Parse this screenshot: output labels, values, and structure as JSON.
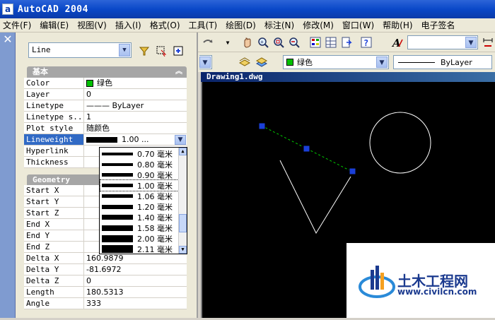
{
  "window": {
    "app_icon": "a",
    "title": "AutoCAD 2004"
  },
  "menu": [
    "文件(F)",
    "编辑(E)",
    "视图(V)",
    "插入(I)",
    "格式(O)",
    "工具(T)",
    "绘图(D)",
    "标注(N)",
    "修改(M)",
    "窗口(W)",
    "帮助(H)",
    "电子签名"
  ],
  "palette": {
    "close_glyph": "✕",
    "object_type": "Line",
    "sections": {
      "basic": "基本",
      "geometry": "Geometry"
    },
    "basic_rows": [
      {
        "name": "Color",
        "value": "绿色",
        "swatch": "#00c000"
      },
      {
        "name": "Layer",
        "value": "0"
      },
      {
        "name": "Linetype",
        "value": "——— ByLayer"
      },
      {
        "name": "Linetype s...",
        "value": "1"
      },
      {
        "name": "Plot style",
        "value": "随颜色"
      },
      {
        "name": "Lineweight",
        "value": "1.00 ..."
      },
      {
        "name": "Hyperlink",
        "value": ""
      },
      {
        "name": "Thickness",
        "value": ""
      }
    ],
    "geometry_rows": [
      {
        "name": "Start X",
        "value": ""
      },
      {
        "name": "Start Y",
        "value": ""
      },
      {
        "name": "Start Z",
        "value": ""
      },
      {
        "name": "End X",
        "value": ""
      },
      {
        "name": "End Y",
        "value": ""
      },
      {
        "name": "End Z",
        "value": ""
      },
      {
        "name": "Delta X",
        "value": "160.9879"
      },
      {
        "name": "Delta Y",
        "value": "-81.6972"
      },
      {
        "name": "Delta Z",
        "value": "0"
      },
      {
        "name": "Length",
        "value": "180.5313"
      },
      {
        "name": "Angle",
        "value": "333"
      }
    ],
    "lineweight_options": [
      {
        "label": "0.70 毫米",
        "weight": 0.7
      },
      {
        "label": "0.80 毫米",
        "weight": 0.8
      },
      {
        "label": "0.90 毫米",
        "weight": 0.9
      },
      {
        "label": "1.00 毫米",
        "weight": 1.0,
        "current": true
      },
      {
        "label": "1.06 毫米",
        "weight": 1.06
      },
      {
        "label": "1.20 毫米",
        "weight": 1.2
      },
      {
        "label": "1.40 毫米",
        "weight": 1.4
      },
      {
        "label": "1.58 毫米",
        "weight": 1.58
      },
      {
        "label": "2.00 毫米",
        "weight": 2.0
      },
      {
        "label": "2.11 毫米",
        "weight": 2.11
      }
    ]
  },
  "toolbar": {
    "layer_color": "绿色",
    "linetype": "ByLayer"
  },
  "drawing": {
    "tab_title": "Drawing1.dwg",
    "line_color": "#ffffff",
    "selected_line_color": "#00cc00",
    "grip_color": "#1a3fd8"
  },
  "watermark": {
    "title": "土木工程网",
    "url": "www.civilcn.com"
  }
}
